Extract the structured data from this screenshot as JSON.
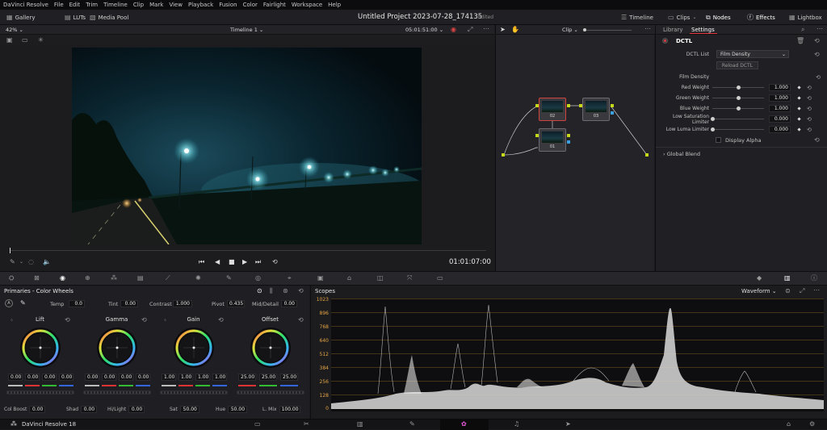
{
  "menubar": {
    "items": [
      "DaVinci Resolve",
      "File",
      "Edit",
      "Trim",
      "Timeline",
      "Clip",
      "Mark",
      "View",
      "Playback",
      "Fusion",
      "Color",
      "Fairlight",
      "Workspace",
      "Help"
    ]
  },
  "header": {
    "left": [
      {
        "label": "Gallery",
        "icon": "gallery-icon"
      },
      {
        "label": "LUTs",
        "icon": "luts-icon"
      },
      {
        "label": "Media Pool",
        "icon": "media-pool-icon"
      }
    ],
    "project_title": "Untitled Project 2023-07-28_174135",
    "edited": "Edited",
    "right": [
      {
        "label": "Timeline",
        "icon": "timeline-icon"
      },
      {
        "label": "Clips",
        "icon": "clips-icon"
      },
      {
        "label": "Nodes",
        "icon": "nodes-icon"
      },
      {
        "label": "Effects",
        "icon": "effects-icon"
      },
      {
        "label": "Lightbox",
        "icon": "lightbox-icon"
      }
    ]
  },
  "viewer": {
    "zoom": "42%",
    "timeline_name": "Timeline 1",
    "timecode_top": "05:01:51:00",
    "timecode_bottom": "01:01:07:00",
    "progress_fraction": 0.0
  },
  "node_editor": {
    "clip_dropdown": "Clip",
    "nodes": [
      "02",
      "03",
      "01"
    ]
  },
  "settings": {
    "tabs": [
      "Library",
      "Settings"
    ],
    "active_tab": "Settings",
    "section": "DCTL",
    "dctl_list_label": "DCTL List",
    "dctl_list_value": "Film Density",
    "reload_button": "Reload DCTL",
    "params": [
      {
        "label": "Film Density",
        "value": "",
        "level": null
      },
      {
        "label": "Red Weight",
        "value": "1.000",
        "level": 0.5
      },
      {
        "label": "Green Weight",
        "value": "1.000",
        "level": 0.5
      },
      {
        "label": "Blue Weight",
        "value": "1.000",
        "level": 0.5
      },
      {
        "label": "Low Saturation Limiter",
        "value": "0.000",
        "level": 0.0
      },
      {
        "label": "Low Luma Limiter",
        "value": "0.000",
        "level": 0.0
      }
    ],
    "display_alpha": "Display Alpha",
    "global_blend": "Global Blend"
  },
  "primaries": {
    "title": "Primaries - Color Wheels",
    "temp_label": "Temp",
    "temp": "0.0",
    "tint_label": "Tint",
    "tint": "0.00",
    "contrast_label": "Contrast",
    "contrast": "1.000",
    "pivot_label": "Pivot",
    "pivot": "0.435",
    "middetail_label": "Mid/Detail",
    "middetail": "0.00",
    "wheels": [
      {
        "name": "Lift",
        "values": [
          "0.00",
          "0.00",
          "0.00",
          "0.00"
        ]
      },
      {
        "name": "Gamma",
        "values": [
          "0.00",
          "0.00",
          "0.00",
          "0.00"
        ]
      },
      {
        "name": "Gain",
        "values": [
          "1.00",
          "1.00",
          "1.00",
          "1.00"
        ]
      },
      {
        "name": "Offset",
        "values": [
          "25.00",
          "25.00",
          "25.00"
        ]
      }
    ],
    "colboost_label": "Col Boost",
    "colboost": "0.00",
    "shad_label": "Shad",
    "shad": "0.00",
    "hilight_label": "Hi/Light",
    "hilight": "0.00",
    "sat_label": "Sat",
    "sat": "50.00",
    "hue_label": "Hue",
    "hue": "50.00",
    "lmix_label": "L. Mix",
    "lmix": "100.00"
  },
  "scopes": {
    "title": "Scopes",
    "mode": "Waveform",
    "scale": [
      "1023",
      "896",
      "768",
      "640",
      "512",
      "384",
      "256",
      "128",
      "0"
    ]
  },
  "footer": {
    "app": "DaVinci Resolve 18"
  },
  "colors": {
    "accent_red": "#e0393e",
    "scope_label": "#e5a542"
  }
}
